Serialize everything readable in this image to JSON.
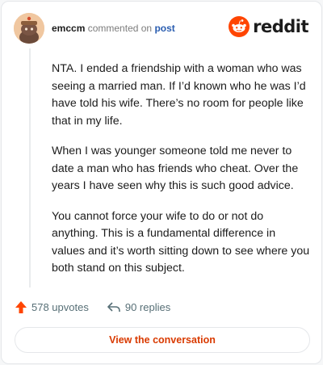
{
  "header": {
    "username": "emccm",
    "action_text": "commented on",
    "post_link": "post",
    "brand": "reddit",
    "avatar_icon": "snoo-avatar-icon",
    "logo_icon": "reddit-logo-icon"
  },
  "comment": {
    "paragraphs": [
      "NTA. I ended a friendship with a woman who was seeing a married man. If I’d known who he was I’d have told his wife. There’s no room for people like that in my life.",
      "When I was younger someone told me never to date a man who has friends who cheat. Over the years I have seen why this is such good advice.",
      "You cannot force your wife to do or not do anything. This is a fundamental difference in values and it’s worth sitting down to see where you both stand on this subject."
    ]
  },
  "actions": {
    "upvotes": "578 upvotes",
    "replies": "90 replies",
    "upvote_icon": "upvote-arrow-icon",
    "reply_icon": "reply-arrow-icon"
  },
  "cta": {
    "label": "View the conversation"
  },
  "colors": {
    "accent": "#ff4500",
    "link": "#2a5db0",
    "cta_text": "#d93a00"
  }
}
